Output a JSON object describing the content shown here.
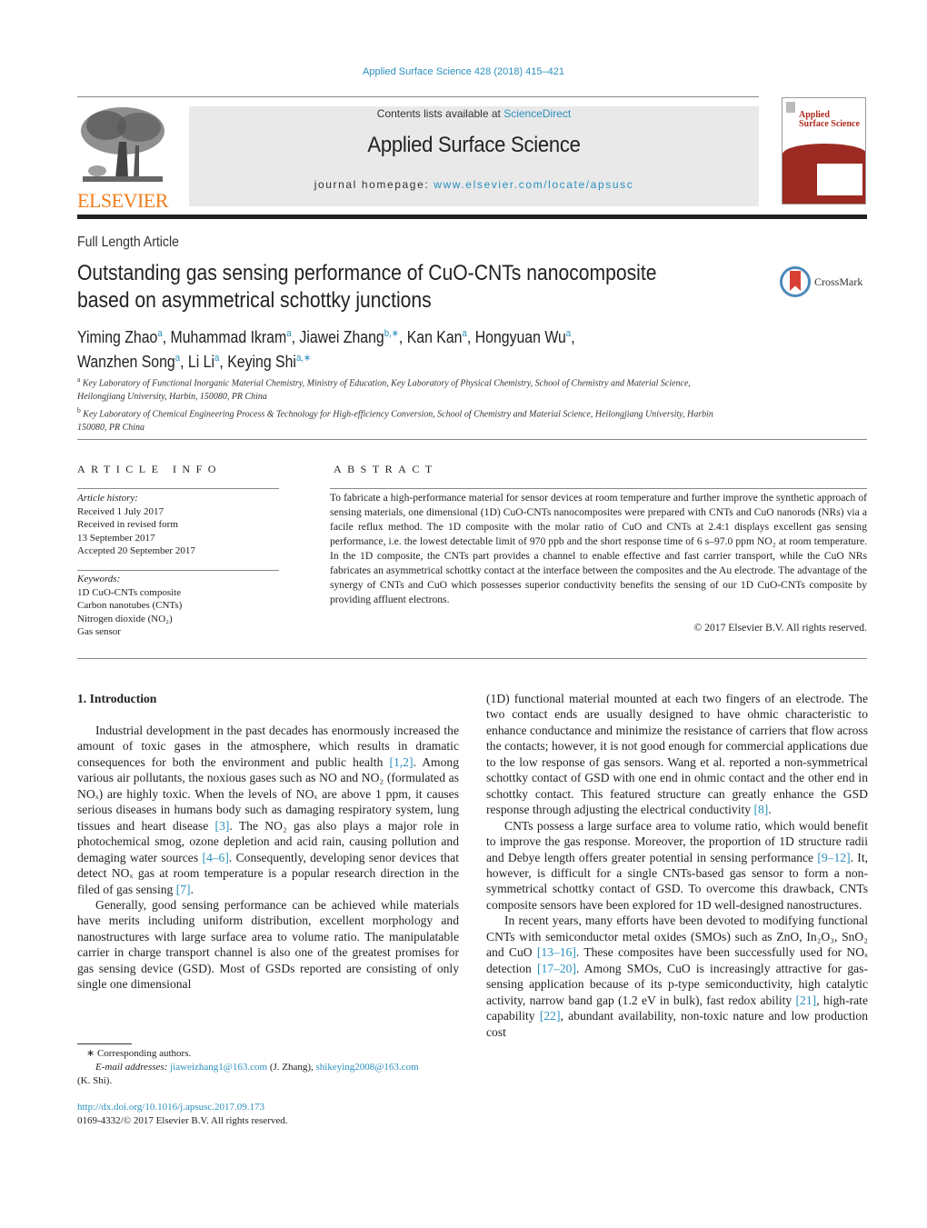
{
  "header": {
    "journal_ref": "Applied Surface Science 428 (2018) 415–421",
    "contents_prefix": "Contents lists available at ",
    "contents_link": "ScienceDirect",
    "journal_title": "Applied Surface Science",
    "homepage_prefix": "journal homepage: ",
    "homepage_link": "www.elsevier.com/locate/apsusc",
    "publisher_wordmark": "ELSEVIER",
    "cover_title_line1": "Applied",
    "cover_title_line2": "Surface Science",
    "brand_colors": {
      "link": "#2a8fbd",
      "elsevier_orange": "#f07d1a",
      "cover_red": "#9c2a22"
    }
  },
  "article": {
    "type": "Full Length Article",
    "title_line1": "Outstanding gas sensing performance of CuO-CNTs nanocomposite",
    "title_line2": "based on asymmetrical schottky junctions",
    "crossmark_label": "CrossMark",
    "authors": [
      {
        "name": "Yiming Zhao",
        "sup": "a"
      },
      {
        "name": "Muhammad Ikram",
        "sup": "a"
      },
      {
        "name": "Jiawei Zhang",
        "sup": "b,∗"
      },
      {
        "name": "Kan Kan",
        "sup": "a"
      },
      {
        "name": "Hongyuan Wu",
        "sup": "a"
      },
      {
        "name": "Wanzhen Song",
        "sup": "a"
      },
      {
        "name": "Li Li",
        "sup": "a"
      },
      {
        "name": "Keying Shi",
        "sup": "a,∗"
      }
    ],
    "affiliations": [
      {
        "mark": "a",
        "text": "Key Laboratory of Functional Inorganic Material Chemistry, Ministry of Education, Key Laboratory of Physical Chemistry, School of Chemistry and Material Science, Heilongjiang University, Harbin, 150080, PR China"
      },
      {
        "mark": "b",
        "text": "Key Laboratory of Chemical Engineering Process & Technology for High-efficiency Conversion, School of Chemistry and Material Science, Heilongjiang University, Harbin 150080, PR China"
      }
    ]
  },
  "article_info": {
    "heading": "ARTICLE INFO",
    "history_label": "Article history:",
    "history": [
      "Received 1 July 2017",
      "Received in revised form",
      "13 September 2017",
      "Accepted 20 September 2017"
    ],
    "keywords_label": "Keywords:",
    "keywords": [
      "1D CuO-CNTs composite",
      "Carbon nanotubes (CNTs)",
      "Nitrogen dioxide (NO₂)",
      "Gas sensor"
    ]
  },
  "abstract": {
    "heading": "ABSTRACT",
    "text": "To fabricate a high-performance material for sensor devices at room temperature and further improve the synthetic approach of sensing materials, one dimensional (1D) CuO-CNTs nanocomposites were prepared with CNTs and CuO nanorods (NRs) via a facile reflux method. The 1D composite with the molar ratio of CuO and CNTs at 2.4:1 displays excellent gas sensing performance, i.e. the lowest detectable limit of 970 ppb and the short response time of 6 s–97.0 ppm NO₂ at room temperature. In the 1D composite, the CNTs part provides a channel to enable effective and fast carrier transport, while the CuO NRs fabricates an asymmetrical schottky contact at the interface between the composites and the Au electrode. The advantage of the synergy of CNTs and CuO which possesses superior conductivity benefits the sensing of our 1D CuO-CNTs composite by providing affluent electrons.",
    "copyright": "© 2017 Elsevier B.V. All rights reserved."
  },
  "body": {
    "section_heading": "1.  Introduction",
    "left": {
      "p1": [
        "Industrial development in the past decades has enormously increased the amount of toxic gases in the atmosphere, which results in dramatic consequences for both the environment and public health ",
        "[1,2]",
        ". Among various air pollutants, the noxious gases such as NO and NO₂ (formulated as NOₓ) are highly toxic. When the levels of NOₓ are above 1 ppm, it causes serious diseases in humans body such as damaging respiratory system, lung tissues and heart disease ",
        "[3]",
        ". The NO₂ gas also plays a major role in photochemical smog, ozone depletion and acid rain, causing pollution and demaging water sources ",
        "[4–6]",
        ". Consequently, developing senor devices that detect NOₓ gas at room temperature is a popular research direction in the filed of gas sensing ",
        "[7]",
        "."
      ],
      "p2": "Generally, good sensing performance can be achieved while materials have merits including uniform distribution, excellent morphology and nanostructures with large surface area to volume ratio. The manipulatable carrier in charge transport channel is also one of the greatest promises for gas sensing device (GSD). Most of GSDs reported are consisting of only single one dimensional"
    },
    "right": {
      "p0": [
        "(1D) functional material mounted at each two fingers of an electrode. The two contact ends are usually designed to have ohmic characteristic to enhance conductance and minimize the resistance of carriers that flow across the contacts; however, it is not good enough for commercial applications due to the low response of gas sensors. Wang et al. reported a non-symmetrical schottky contact of GSD with one end in ohmic contact and the other end in schottky contact. This featured structure can greatly enhance the GSD response through adjusting the electrical conductivity ",
        "[8]",
        "."
      ],
      "p1": [
        "CNTs possess a large surface area to volume ratio, which would benefit to improve the gas response. Moreover, the proportion of 1D structure radii and Debye length offers greater potential in sensing performance ",
        "[9–12]",
        ". It, however, is difficult for a single CNTs-based gas sensor to form a non-symmetrical schottky contact of GSD. To overcome this drawback, CNTs composite sensors have been explored for 1D well-designed nanostructures."
      ],
      "p2": [
        "In recent years, many efforts have been devoted to modifying functional CNTs with semiconductor metal oxides (SMOs) such as ZnO, In₂O₃, SnO₂ and CuO ",
        "[13–16]",
        ". These composites have been successfully used for NOₓ detection ",
        "[17–20]",
        ". Among SMOs, CuO is increasingly attractive for gas-sensing application because of its p-type semiconductivity, high catalytic activity, narrow band gap (1.2 eV in bulk), fast redox ability ",
        "[21]",
        ", high-rate capability ",
        "[22]",
        ", abundant availability, non-toxic nature and low production cost"
      ]
    }
  },
  "footnotes": {
    "corresponding": "∗  Corresponding authors.",
    "email_label": "E-mail addresses:",
    "email1": "jiaweizhang1@163.com",
    "email1_owner": " (J. Zhang), ",
    "email2": "shikeying2008@163.com",
    "email2_owner": "(K. Shi).",
    "doi": "http://dx.doi.org/10.1016/j.apsusc.2017.09.173",
    "issn": "0169-4332/© 2017 Elsevier B.V. All rights reserved."
  }
}
